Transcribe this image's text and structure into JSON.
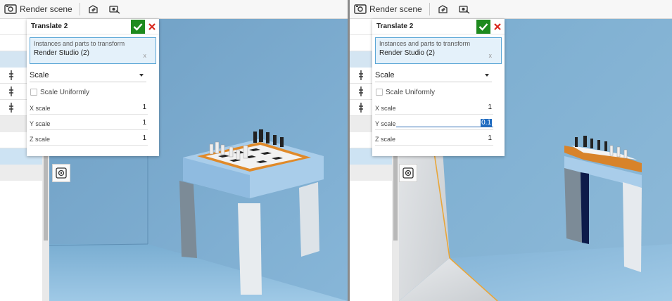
{
  "toolbar": {
    "render_label": "Render scene",
    "icons": [
      "render-scene-icon",
      "appearance-icon",
      "camera-visibility-icon"
    ]
  },
  "panels": [
    {
      "title": "Translate 2",
      "selection_label": "Instances and parts to transform",
      "selection_value": "Render Studio (2)",
      "selection_clear": "x",
      "mode": "Scale",
      "scale_uniformly_label": "Scale Uniformly",
      "scale_uniformly_checked": false,
      "fields": [
        {
          "label": "X scale",
          "value": "1"
        },
        {
          "label": "Y scale",
          "value": "1"
        },
        {
          "label": "Z scale",
          "value": "1"
        }
      ]
    },
    {
      "title": "Translate 2",
      "selection_label": "Instances and parts to transform",
      "selection_value": "Render Studio (2)",
      "selection_clear": "x",
      "mode": "Scale",
      "scale_uniformly_label": "Scale Uniformly",
      "scale_uniformly_checked": false,
      "fields": [
        {
          "label": "X scale",
          "value": "1"
        },
        {
          "label": "Y scale",
          "value": "0.1"
        },
        {
          "label": "Z scale",
          "value": "1"
        }
      ]
    }
  ],
  "colors": {
    "accept": "#1e8a1e",
    "cancel": "#d9281e",
    "selection_border": "#5aa6d6",
    "selection_bg": "#e4f1fa",
    "viewport_blue": "#7aaed2",
    "table_orange": "#e08a2a"
  }
}
